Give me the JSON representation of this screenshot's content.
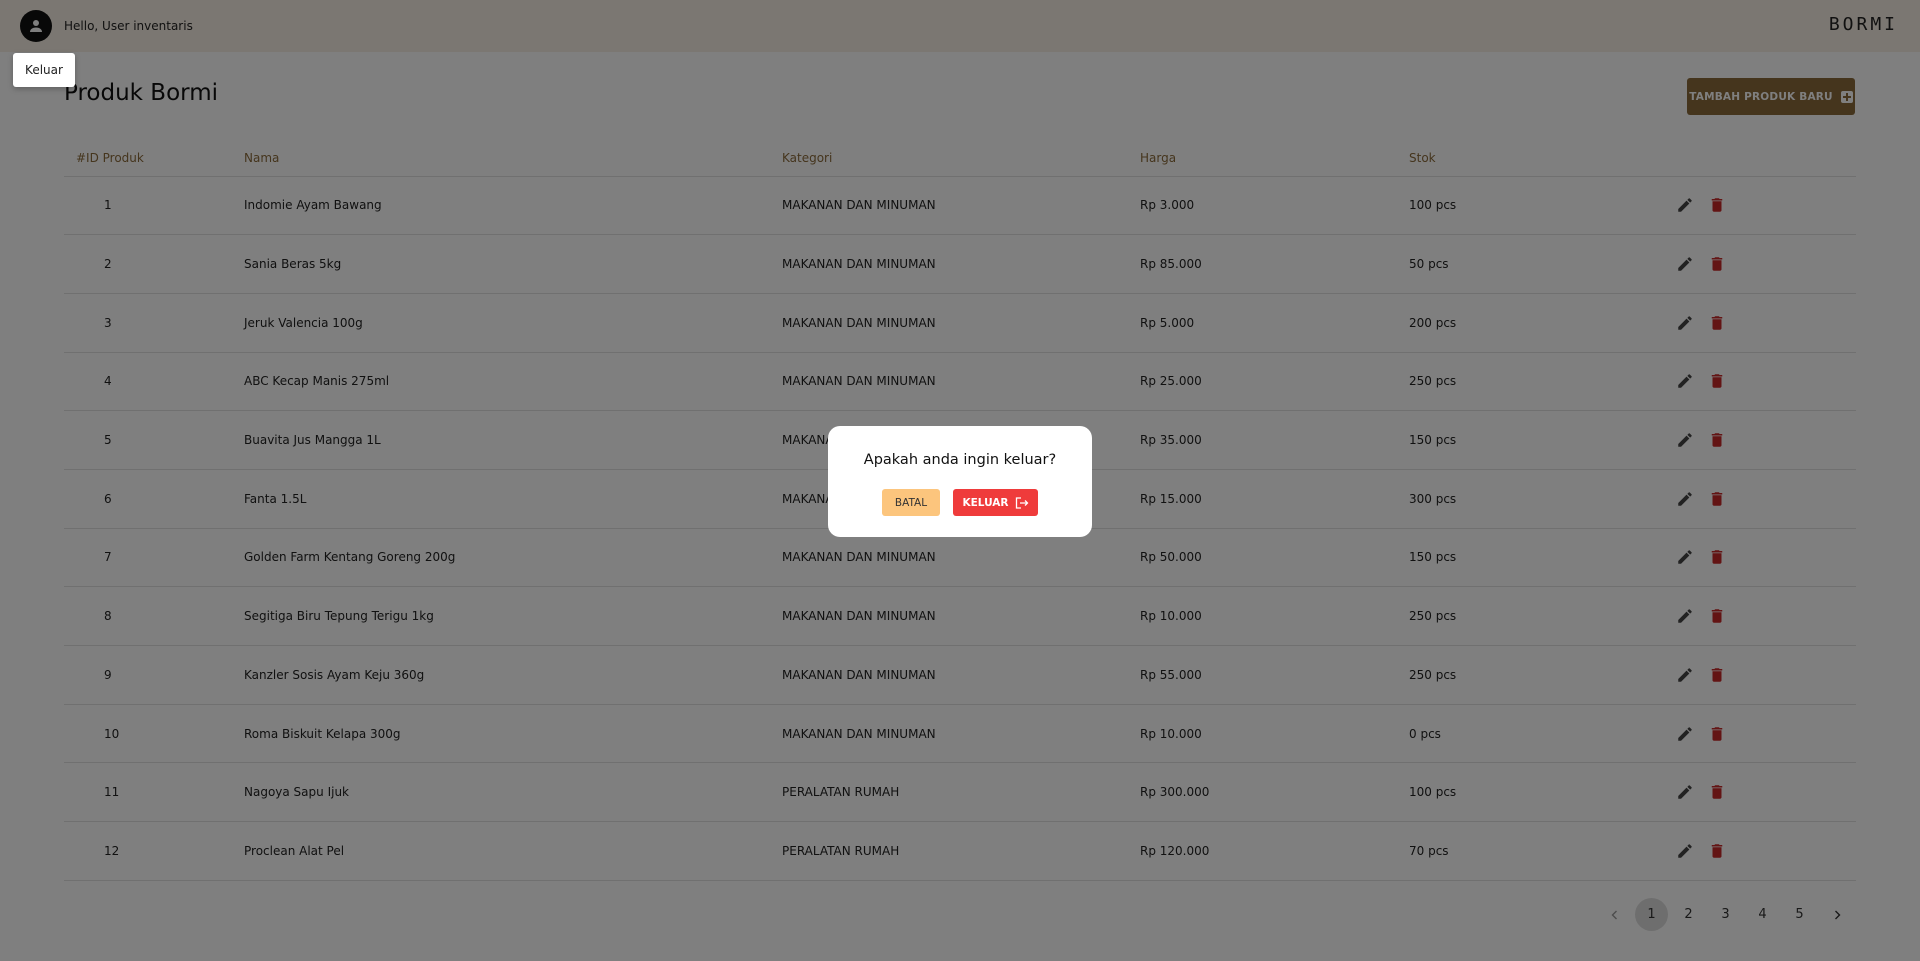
{
  "header": {
    "greeting": "Hello, User inventaris",
    "brand": "BORMI",
    "menu_logout": "Keluar"
  },
  "page": {
    "title": "Produk Bormi",
    "add_button": "TAMBAH PRODUK BARU"
  },
  "table": {
    "columns": [
      "#ID Produk",
      "Nama",
      "Kategori",
      "Harga",
      "Stok"
    ],
    "rows": [
      {
        "id": "1",
        "name": "Indomie Ayam Bawang",
        "category": "MAKANAN DAN MINUMAN",
        "price": "Rp 3.000",
        "stock": "100 pcs"
      },
      {
        "id": "2",
        "name": "Sania Beras 5kg",
        "category": "MAKANAN DAN MINUMAN",
        "price": "Rp 85.000",
        "stock": "50 pcs"
      },
      {
        "id": "3",
        "name": "Jeruk Valencia 100g",
        "category": "MAKANAN DAN MINUMAN",
        "price": "Rp 5.000",
        "stock": "200 pcs"
      },
      {
        "id": "4",
        "name": "ABC Kecap Manis 275ml",
        "category": "MAKANAN DAN MINUMAN",
        "price": "Rp 25.000",
        "stock": "250 pcs"
      },
      {
        "id": "5",
        "name": "Buavita Jus Mangga 1L",
        "category": "MAKANAN DAN MINUMAN",
        "price": "Rp 35.000",
        "stock": "150 pcs"
      },
      {
        "id": "6",
        "name": "Fanta 1.5L",
        "category": "MAKANAN DAN MINUMAN",
        "price": "Rp 15.000",
        "stock": "300 pcs"
      },
      {
        "id": "7",
        "name": "Golden Farm Kentang Goreng 200g",
        "category": "MAKANAN DAN MINUMAN",
        "price": "Rp 50.000",
        "stock": "150 pcs"
      },
      {
        "id": "8",
        "name": "Segitiga Biru Tepung Terigu 1kg",
        "category": "MAKANAN DAN MINUMAN",
        "price": "Rp 10.000",
        "stock": "250 pcs"
      },
      {
        "id": "9",
        "name": "Kanzler Sosis Ayam Keju 360g",
        "category": "MAKANAN DAN MINUMAN",
        "price": "Rp 55.000",
        "stock": "250 pcs"
      },
      {
        "id": "10",
        "name": "Roma Biskuit Kelapa 300g",
        "category": "MAKANAN DAN MINUMAN",
        "price": "Rp 10.000",
        "stock": "0 pcs"
      },
      {
        "id": "11",
        "name": "Nagoya Sapu Ijuk",
        "category": "PERALATAN RUMAH",
        "price": "Rp 300.000",
        "stock": "100 pcs"
      },
      {
        "id": "12",
        "name": "Proclean Alat Pel",
        "category": "PERALATAN RUMAH",
        "price": "Rp 120.000",
        "stock": "70 pcs"
      }
    ]
  },
  "pagination": {
    "pages": [
      "1",
      "2",
      "3",
      "4",
      "5"
    ],
    "active": "1"
  },
  "modal": {
    "question": "Apakah anda ingin keluar?",
    "cancel_label": "BATAL",
    "confirm_label": "KELUAR"
  },
  "colors": {
    "accent": "#8b6a3a",
    "danger": "#ef3b3b",
    "cancel": "#fcc57d"
  }
}
